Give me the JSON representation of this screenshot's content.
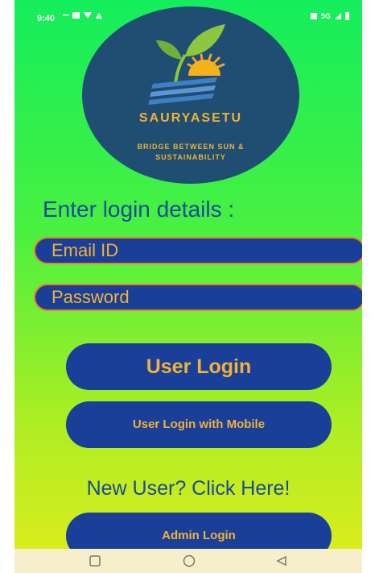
{
  "status_bar": {
    "time": "9:40",
    "network": "5G"
  },
  "logo": {
    "title": "SAURYASETU",
    "tagline": "BRIDGE BETWEEN SUN & SUSTAINABILITY"
  },
  "login": {
    "heading": "Enter login details :",
    "email_placeholder": "Email ID",
    "password_placeholder": "Password",
    "user_login_label": "User Login",
    "mobile_login_label": "User Login with Mobile",
    "new_user_label": "New User? Click Here!",
    "admin_login_label": "Admin Login"
  },
  "colors": {
    "button_bg": "#1a3f99",
    "button_text": "#f2b233",
    "field_border": "#f07d2a",
    "heading_text": "#1a4a98",
    "logo_bg": "#1f4e72"
  },
  "icons": {
    "nav_recents": "square-icon",
    "nav_home": "circle-icon",
    "nav_back": "triangle-back-icon"
  }
}
